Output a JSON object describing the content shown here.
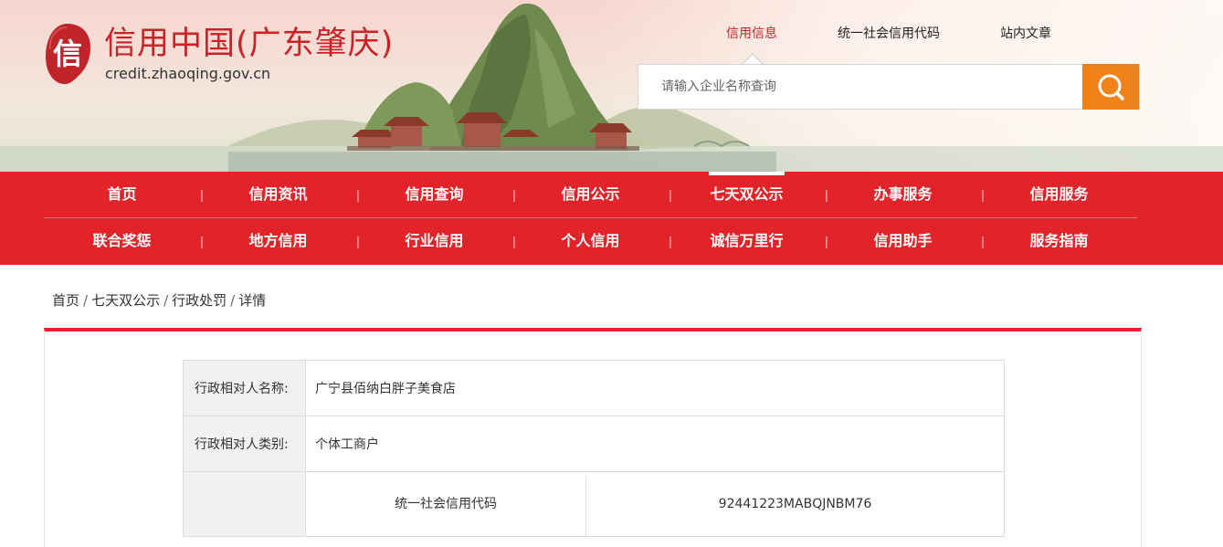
{
  "header": {
    "title": "信用中国(广东肇庆)",
    "domain": "credit.zhaoqing.gov.cn",
    "logo_char": "信"
  },
  "top_links": [
    {
      "label": "信用信息",
      "active": true
    },
    {
      "label": "统一社会信用代码",
      "active": false
    },
    {
      "label": "站内文章",
      "active": false
    }
  ],
  "search": {
    "placeholder": "请输入企业名称查询",
    "button_icon": "search-icon"
  },
  "nav": {
    "row1": [
      "首页",
      "信用资讯",
      "信用查询",
      "信用公示",
      "七天双公示",
      "办事服务",
      "信用服务"
    ],
    "row2": [
      "联合奖惩",
      "地方信用",
      "行业信用",
      "个人信用",
      "诚信万里行",
      "信用助手",
      "服务指南"
    ],
    "active": "七天双公示",
    "separator": "|"
  },
  "breadcrumb": [
    "首页",
    "七天双公示",
    "行政处罚",
    "详情"
  ],
  "breadcrumb_sep": "/",
  "detail": {
    "rows": [
      {
        "label": "行政相对人名称:",
        "value": "广宁县佰纳白胖子美食店"
      },
      {
        "label": "行政相对人类别:",
        "value": "个体工商户"
      }
    ],
    "code_row": {
      "sub_label": "统一社会信用代码",
      "sub_value": "92441223MABQJNBM76"
    }
  },
  "colors": {
    "brand_red": "#e2242a",
    "title_red": "#cc2127",
    "search_orange": "#f08219"
  }
}
